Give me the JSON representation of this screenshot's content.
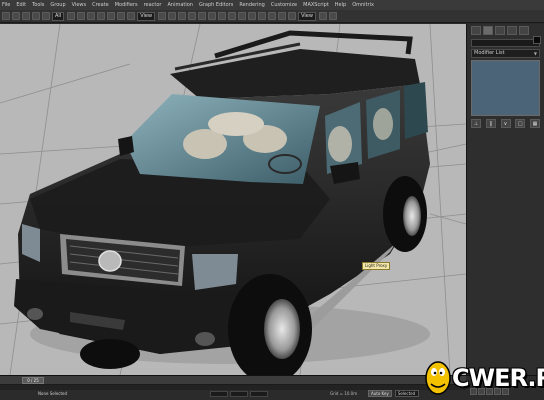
{
  "menu": {
    "items": [
      "File",
      "Edit",
      "Tools",
      "Group",
      "Views",
      "Create",
      "Modifiers",
      "reactor",
      "Animation",
      "Graph Editors",
      "Rendering",
      "Customize",
      "MAXScript",
      "Help",
      "Omnitrix"
    ]
  },
  "toolbar": {
    "selection_filter": "All",
    "ref_coord": "View",
    "view_dropdown": "View"
  },
  "viewport": {
    "label": "",
    "tooltip": "Light Proxy",
    "background": "#b8b8b8"
  },
  "command_panel": {
    "modifier_list": "Modifier List",
    "stack_color": "#4c6478"
  },
  "status": {
    "time_display": "0 / 25",
    "selection_text": "None Selected",
    "grid_text": "Grid = 10.0m",
    "auto_key": "Auto Key",
    "key_filter": "Selected"
  },
  "watermark": {
    "text": "CWER.RU"
  }
}
